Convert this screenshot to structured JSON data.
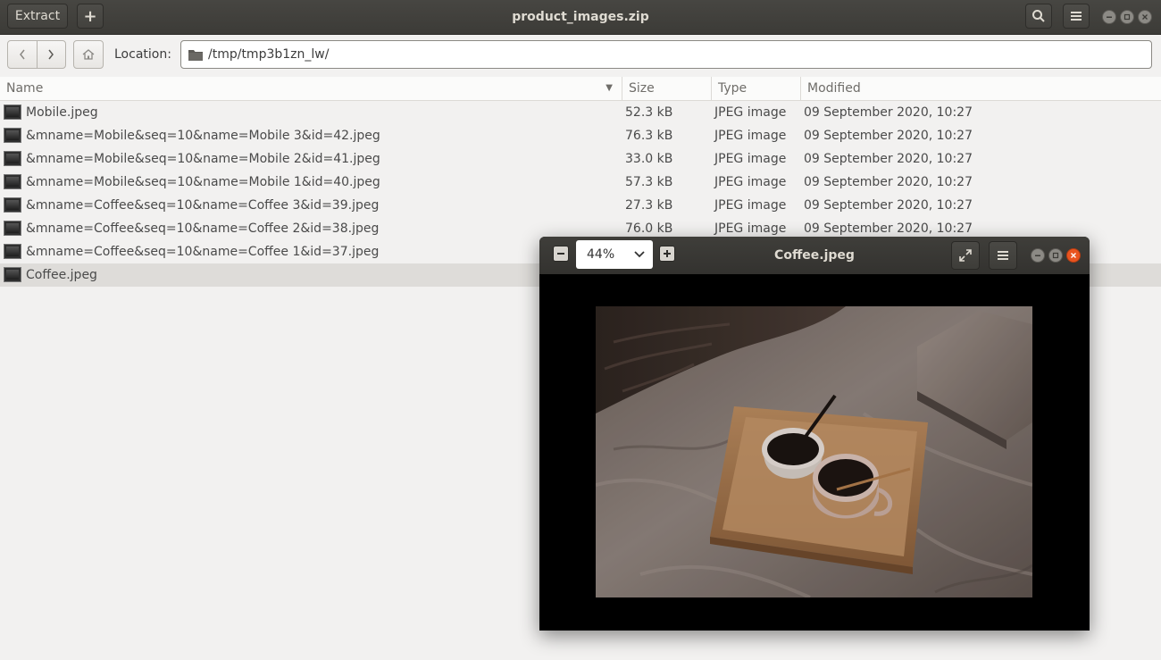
{
  "archive": {
    "extract_label": "Extract",
    "add_label": "+",
    "title": "product_images.zip",
    "location_label": "Location:",
    "location_path": "/tmp/tmp3b1zn_lw/",
    "columns": {
      "name": "Name",
      "size": "Size",
      "type": "Type",
      "modified": "Modified"
    },
    "files": [
      {
        "name": "Mobile.jpeg",
        "size": "52.3 kB",
        "type": "JPEG image",
        "modified": "09 September 2020, 10:27"
      },
      {
        "name": "&mname=Mobile&seq=10&name=Mobile 3&id=42.jpeg",
        "size": "76.3 kB",
        "type": "JPEG image",
        "modified": "09 September 2020, 10:27"
      },
      {
        "name": "&mname=Mobile&seq=10&name=Mobile 2&id=41.jpeg",
        "size": "33.0 kB",
        "type": "JPEG image",
        "modified": "09 September 2020, 10:27"
      },
      {
        "name": "&mname=Mobile&seq=10&name=Mobile 1&id=40.jpeg",
        "size": "57.3 kB",
        "type": "JPEG image",
        "modified": "09 September 2020, 10:27"
      },
      {
        "name": "&mname=Coffee&seq=10&name=Coffee 3&id=39.jpeg",
        "size": "27.3 kB",
        "type": "JPEG image",
        "modified": "09 September 2020, 10:27"
      },
      {
        "name": "&mname=Coffee&seq=10&name=Coffee 2&id=38.jpeg",
        "size": "76.0 kB",
        "type": "JPEG image",
        "modified": "09 September 2020, 10:27"
      },
      {
        "name": "&mname=Coffee&seq=10&name=Coffee 1&id=37.jpeg",
        "size": "",
        "type": "",
        "modified": ""
      },
      {
        "name": "Coffee.jpeg",
        "size": "",
        "type": "",
        "modified": ""
      }
    ],
    "selected_index": 7
  },
  "viewer": {
    "title": "Coffee.jpeg",
    "zoom": "44%"
  },
  "colors": {
    "headerbar": "#3c3b37",
    "accent_close": "#e95420",
    "selection": "#dedcd9"
  }
}
